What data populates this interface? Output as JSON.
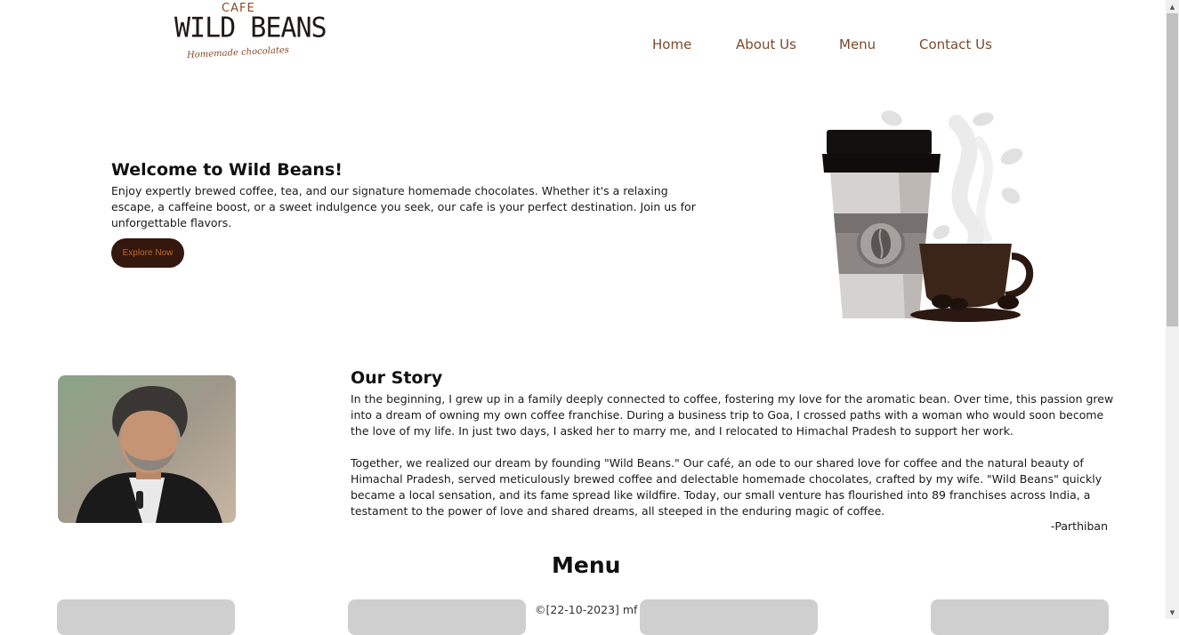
{
  "logo": {
    "top_text": "CAFE",
    "main_text": "WILD BEANS",
    "tagline": "Homemade chocolates"
  },
  "nav": {
    "items": [
      {
        "label": "Home"
      },
      {
        "label": "About Us"
      },
      {
        "label": "Menu"
      },
      {
        "label": "Contact Us"
      }
    ]
  },
  "hero": {
    "title": "Welcome to Wild Beans!",
    "text": "Enjoy expertly brewed coffee, tea, and our signature homemade chocolates. Whether it's a relaxing escape, a caffeine boost, or a sweet indulgence you seek, our cafe is your perfect destination. Join us for unforgettable flavors.",
    "button_label": "Explore Now",
    "illustration_icon": "coffee-cups-illustration"
  },
  "story": {
    "title": "Our Story",
    "paragraphs": [
      "In the beginning, I grew up in a family deeply connected to coffee, fostering my love for the aromatic bean. Over time, this passion grew into a dream of owning my own coffee franchise. During a business trip to Goa, I crossed paths with a woman who would soon become the love of my life. In just two days, I asked her to marry me, and I relocated to Himachal Pradesh to support her work.",
      "Together, we realized our dream by founding \"Wild Beans.\" Our café, an ode to our shared love for coffee and the natural beauty of Himachal Pradesh, served meticulously brewed coffee and delectable homemade chocolates, crafted by my wife. \"Wild Beans\" quickly became a local sensation, and its fame spread like wildfire. Today, our small venture has flourished into 89 franchises across India, a testament to the power of love and shared dreams, all steeped in the enduring magic of coffee."
    ],
    "signature": "-Parthiban"
  },
  "menu": {
    "title": "Menu"
  },
  "footer": {
    "text": "©[22-10-2023] mf"
  },
  "colors": {
    "brand_brown": "#7a4a2c",
    "button_bg": "#34170d",
    "button_text": "#c0692d"
  }
}
